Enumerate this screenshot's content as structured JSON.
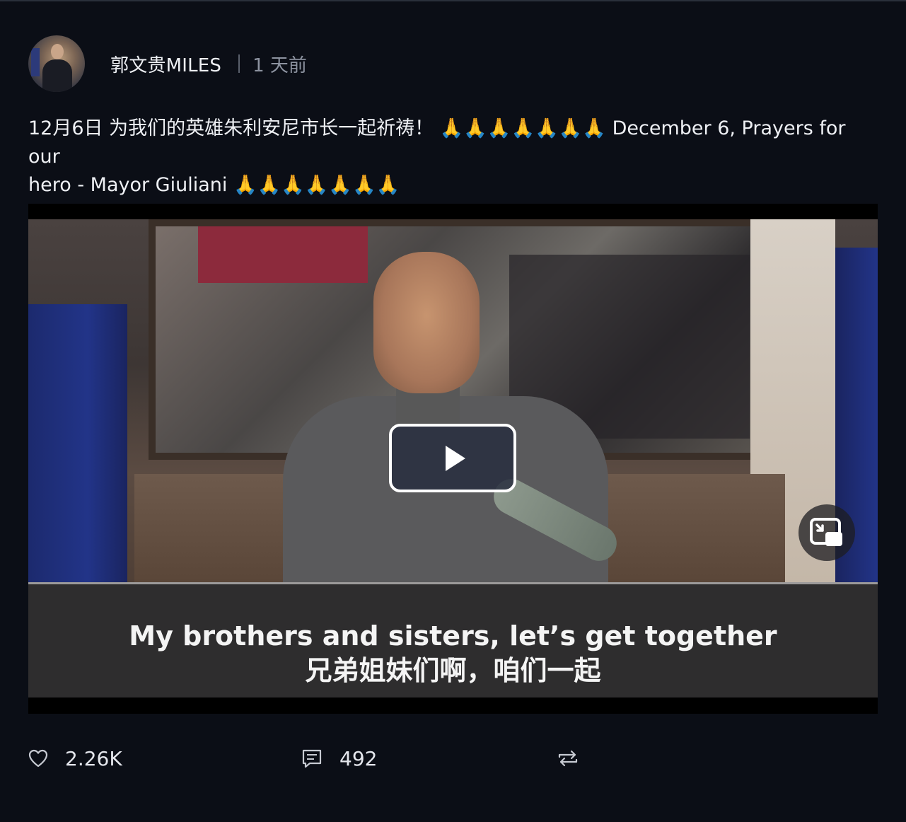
{
  "post": {
    "username": "郭文贵MILES",
    "time_ago": "1 天前",
    "text_line1": "12月6日 为我们的英雄朱利安尼市长一起祈祷！ 🙏🙏🙏🙏🙏🙏🙏 December 6, Prayers for our",
    "text_line2": "hero - Mayor Giuliani 🙏🙏🙏🙏🙏🙏🙏"
  },
  "video": {
    "caption_en": "My brothers and sisters, let’s get together",
    "caption_zh": "兄弟姐妹们啊，咱们一起",
    "play_icon": "play-icon",
    "pip_icon": "picture-in-picture-icon"
  },
  "actions": {
    "likes": "2.26K",
    "comments": "492",
    "like_icon": "heart-icon",
    "comment_icon": "comment-icon",
    "repost_icon": "repost-icon"
  }
}
